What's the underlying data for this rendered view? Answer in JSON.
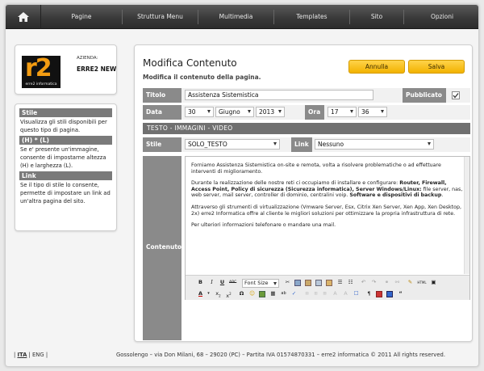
{
  "nav": {
    "items": [
      "Pagine",
      "Struttura Menu",
      "Multimedia",
      "Templates",
      "Sito",
      "Opzioni"
    ]
  },
  "company": {
    "label": "AZIENDA:",
    "name": "ERRE2 NEW",
    "logo_text": "r2",
    "logo_sub": "erre2 informatica"
  },
  "help": {
    "h1": "Stile",
    "p1": "Visualizza gli stili disponibili per questo tipo di pagina.",
    "h2": "(H) * (L)",
    "p2": "Se e' presente un'immagine, consente di impostarne altezza (H) e larghezza (L).",
    "h3": "Link",
    "p3": "Se il tipo di stile lo consente, permette di impostare un link ad un'altra pagina del sito."
  },
  "panel": {
    "title": "Modifica Contenuto",
    "subtitle": "Modifica il contenuto della pagina.",
    "cancel_label": "Annulla",
    "save_label": "Salva"
  },
  "form": {
    "title_label": "Titolo",
    "title_value": "Assistenza Sistemistica",
    "published_label": "Pubblicato",
    "published_checked": true,
    "date_label": "Data",
    "day": "30",
    "month": "Giugno",
    "year": "2013",
    "time_label": "Ora",
    "hour": "17",
    "minute": "36",
    "section_label": "TESTO - IMMAGINI - VIDEO",
    "style_label": "Stile",
    "style_value": "SOLO_TESTO",
    "link_label": "Link",
    "link_value": "Nessuno",
    "content_label": "Contenuto"
  },
  "editor": {
    "p1": "Forniamo Assistenza Sistemistica on-site e remota, volta a risolvere problematiche o ad effettuare interventi di miglioramento.",
    "p2_a": "Durante la realizzazione delle nostre reti ci occupiamo di installare e configurare: ",
    "p2_b": "Router, Firewall, Access Point, Policy di sicurezza (Sicurezza informatica), Server Windows/Linux:",
    "p2_c": " file server, nas, web server, mail server, controller di dominio, centralini voip. ",
    "p2_d": "Software e dispositivi di backup",
    "p2_e": ".",
    "p3": "Attraverso gli strumenti di virtualizzazione (Vmware Server, Esx, Citrix Xen Server, Xen App, Xen Desktop, 2x) erre2 Informatica offre al cliente le migliori soluzioni per ottimizzare la propria infrastruttura di rete.",
    "p4": "Per ulteriori informazioni telefonare o mandare una mail.",
    "font_size_label": "Font Size"
  },
  "footer": {
    "lang_it": "ITA",
    "lang_en": "ENG",
    "copyright": "Gossolengo – via Don Milani, 68 – 29020 (PC) – Partita IVA 01574870331 – erre2 informatica © 2011 All rights reserved."
  },
  "colors": {
    "accent": "#f2b200",
    "label_bg": "#8a8a8a",
    "nav_bg": "#3a3a3a"
  }
}
